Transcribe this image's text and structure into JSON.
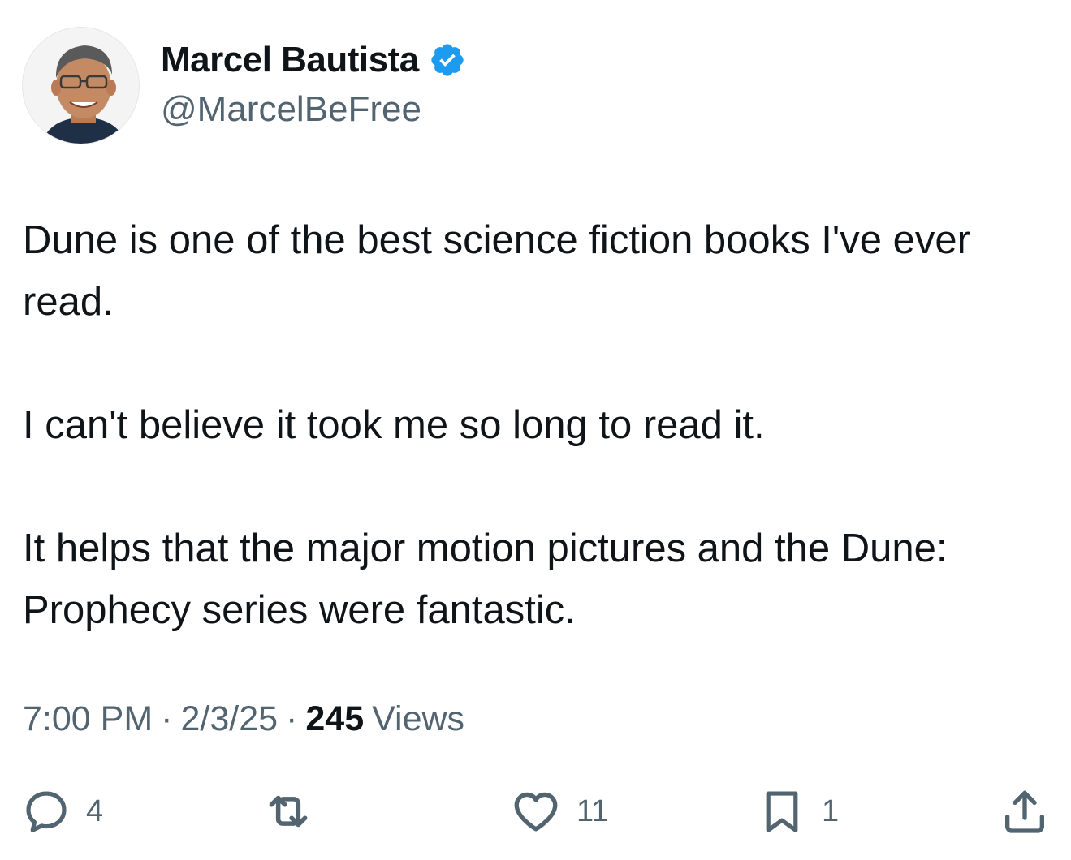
{
  "author": {
    "display_name": "Marcel Bautista",
    "handle": "@MarcelBeFree",
    "verified": true,
    "avatar_icon": "profile-photo"
  },
  "tweet": {
    "paragraphs": [
      "Dune is one of the best science fiction books I've ever read.",
      "I can't believe it took me so long to read it.",
      "It helps that the major motion pictures and the Dune: Prophecy series were fantastic."
    ],
    "time": "7:00 PM",
    "separator": "·",
    "date": "2/3/25",
    "views_count": "245",
    "views_label": "Views"
  },
  "actions": {
    "reply": {
      "icon": "reply-icon",
      "count": "4"
    },
    "repost": {
      "icon": "repost-icon",
      "count": ""
    },
    "like": {
      "icon": "heart-icon",
      "count": "11"
    },
    "bookmark": {
      "icon": "bookmark-icon",
      "count": "1"
    },
    "share": {
      "icon": "share-icon"
    }
  },
  "colors": {
    "text_primary": "#0f1419",
    "text_secondary": "#536471",
    "verified_blue": "#1d9bf0"
  }
}
